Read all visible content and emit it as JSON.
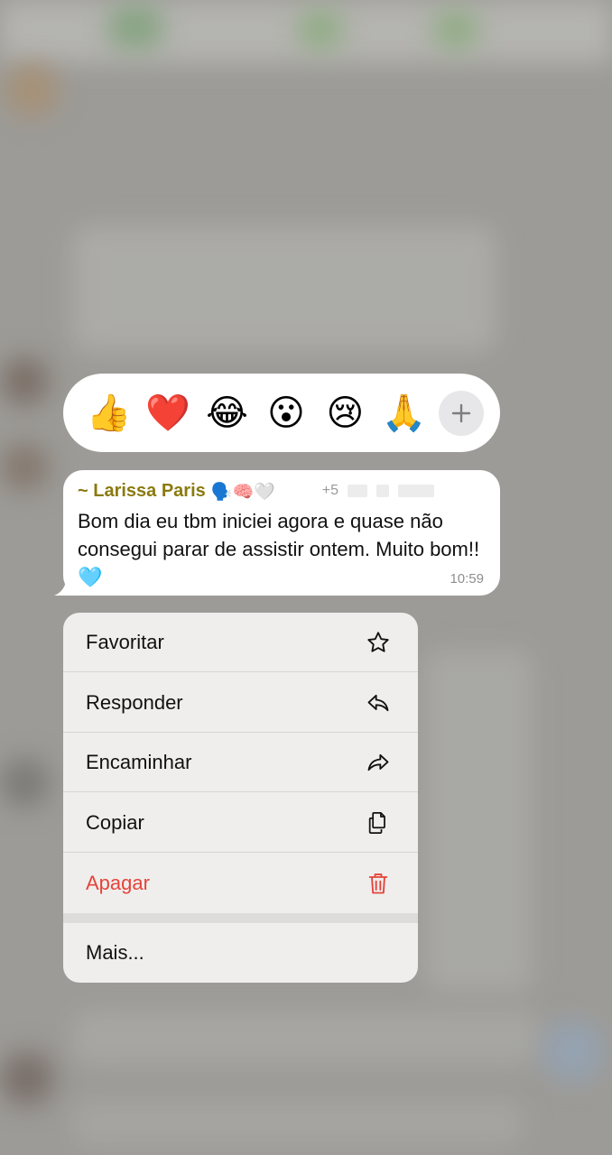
{
  "reactions": {
    "emojis": [
      {
        "char": "👍",
        "name": "thumbs-up"
      },
      {
        "char": "❤️",
        "name": "heart"
      },
      {
        "char": "😂",
        "name": "laughing"
      },
      {
        "char": "😮",
        "name": "surprised"
      },
      {
        "char": "😢",
        "name": "crying"
      },
      {
        "char": "🙏",
        "name": "praying-hands"
      }
    ],
    "more_icon": "plus-icon"
  },
  "message": {
    "sender": "~ Larissa Paris",
    "sender_emojis": "🗣️🧠🤍",
    "phone_prefix": "+5",
    "text": "Bom dia eu tbm iniciei agora e quase não consegui parar de assistir ontem. Muito bom!!",
    "text_emoji": "🩵",
    "time": "10:59"
  },
  "menu": {
    "favorite_label": "Favoritar",
    "reply_label": "Responder",
    "forward_label": "Encaminhar",
    "copy_label": "Copiar",
    "delete_label": "Apagar",
    "more_label": "Mais...",
    "danger_color": "#e5443a"
  }
}
